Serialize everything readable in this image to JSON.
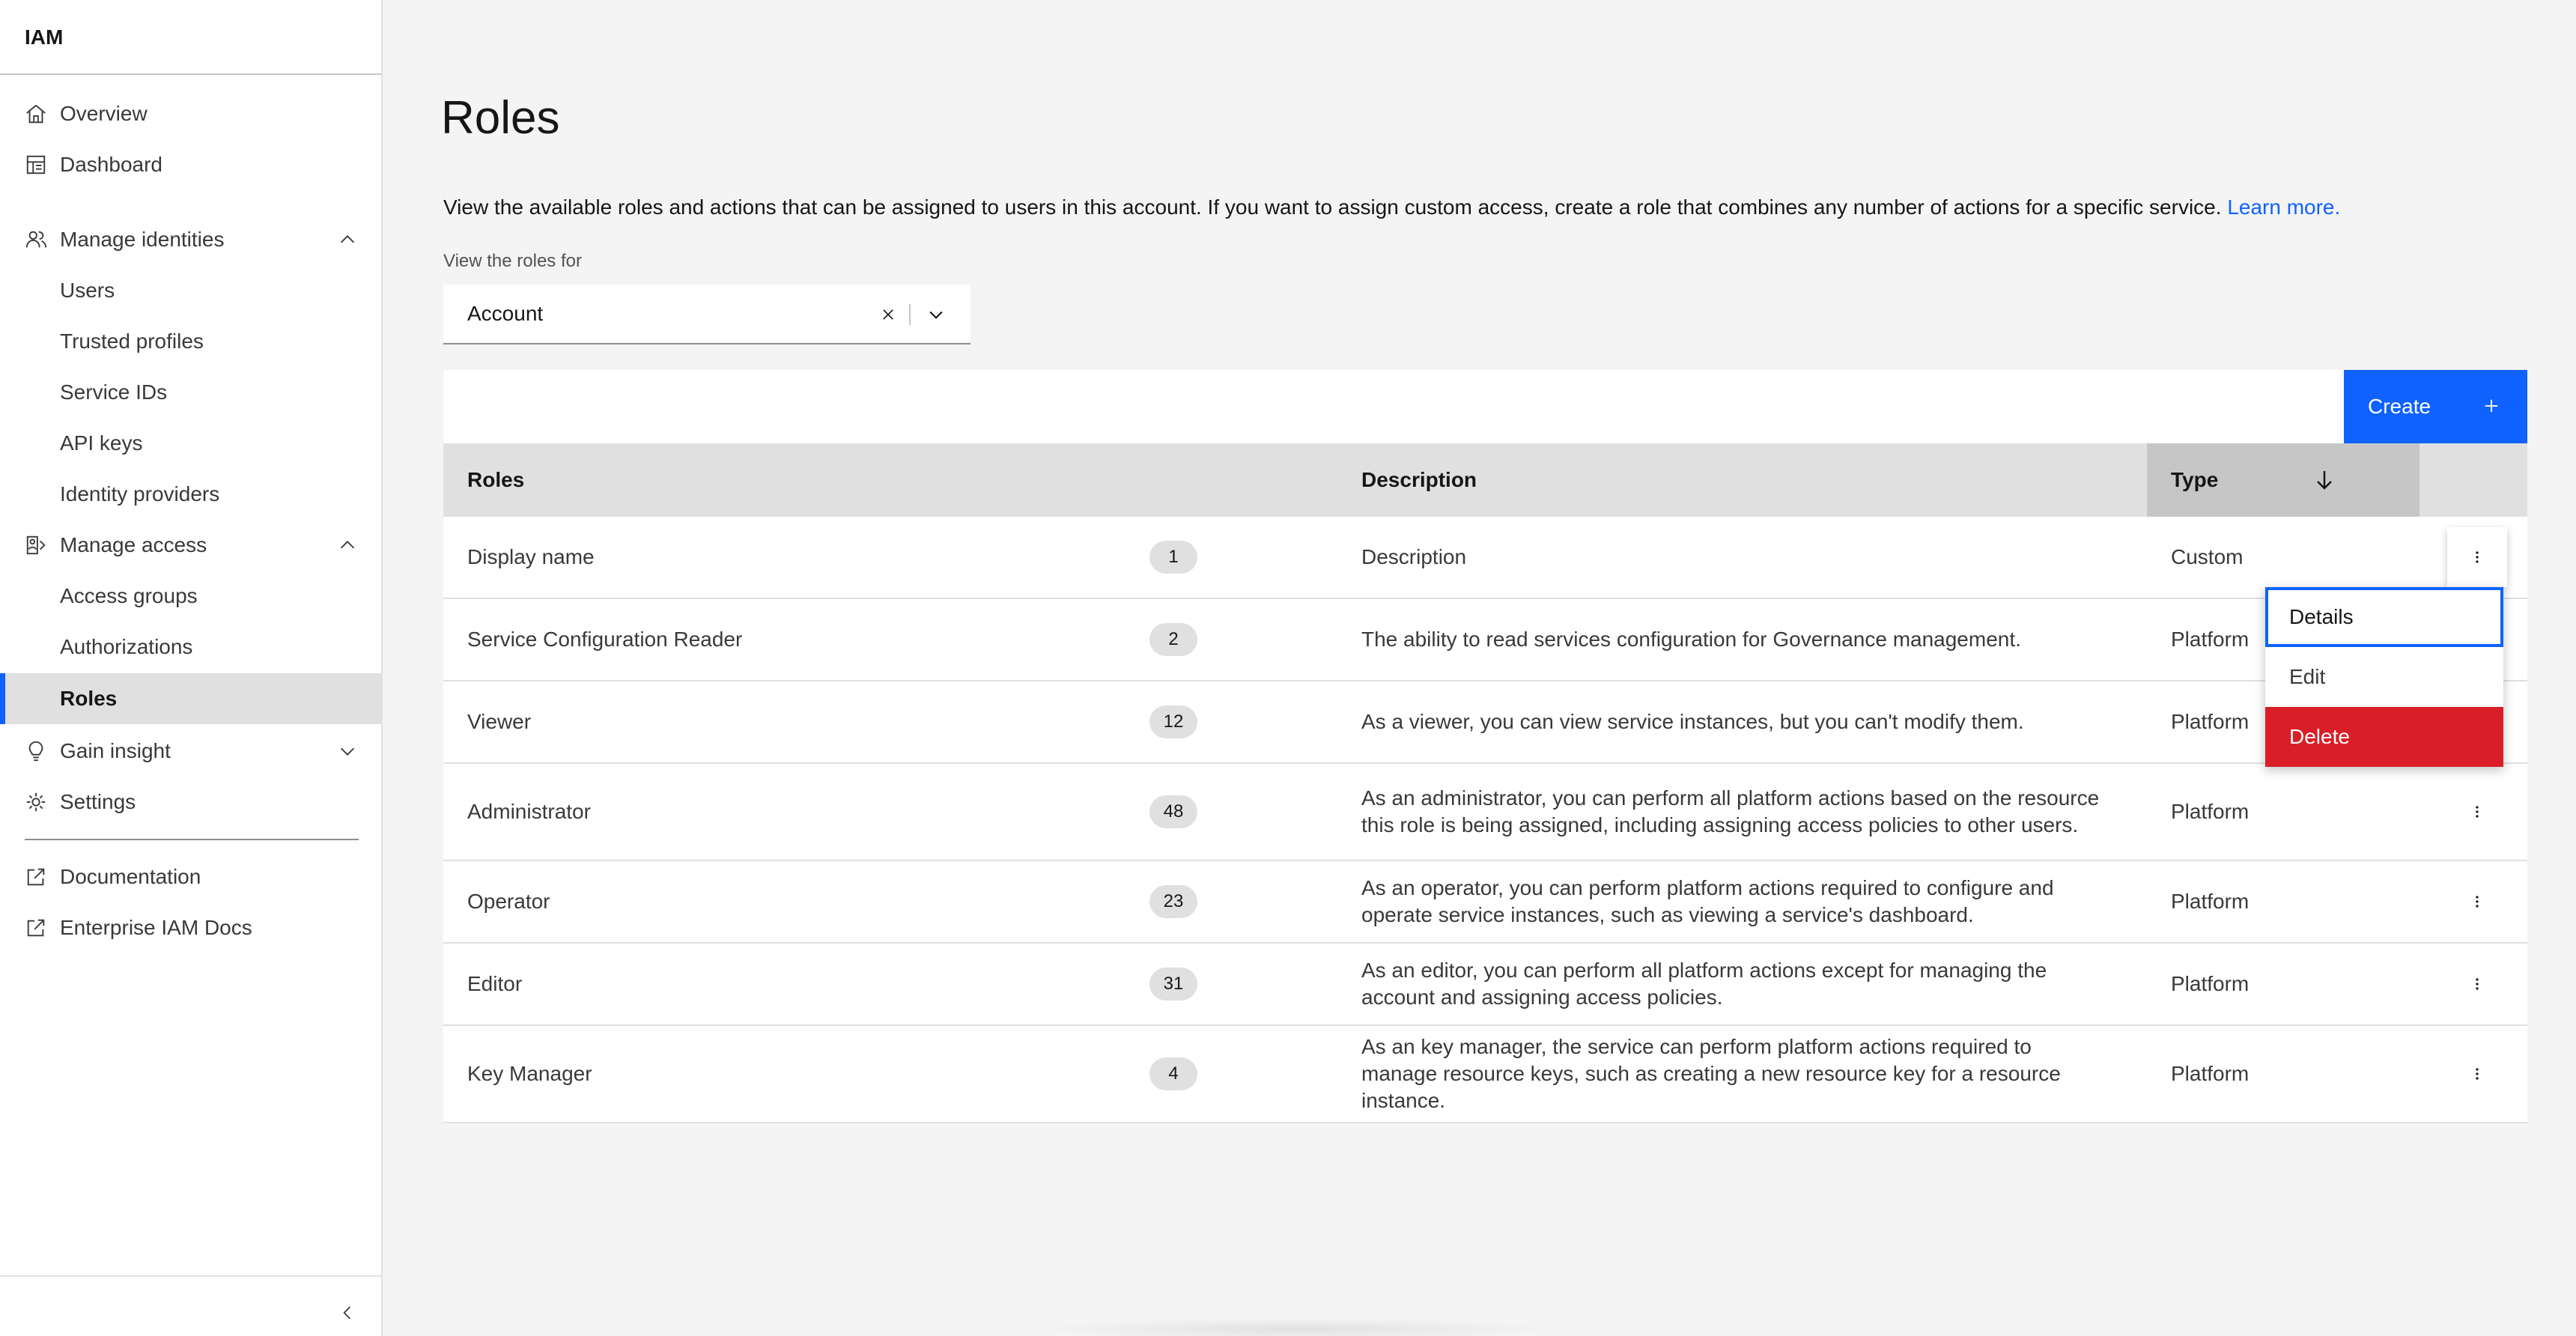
{
  "sidebar": {
    "title": "IAM",
    "items": [
      {
        "label": "Overview",
        "icon": "home-icon"
      },
      {
        "label": "Dashboard",
        "icon": "dashboard-icon"
      },
      {
        "label": "Manage identities",
        "icon": "user-multiple-icon",
        "expanded": true
      },
      {
        "label": "Users"
      },
      {
        "label": "Trusted profiles"
      },
      {
        "label": "Service IDs"
      },
      {
        "label": "API keys"
      },
      {
        "label": "Identity providers"
      },
      {
        "label": "Manage access",
        "icon": "access-icon",
        "expanded": true
      },
      {
        "label": "Access groups"
      },
      {
        "label": "Authorizations"
      },
      {
        "label": "Roles",
        "active": true
      },
      {
        "label": "Gain insight",
        "icon": "lightbulb-icon",
        "expanded": false
      },
      {
        "label": "Settings",
        "icon": "gear-icon"
      },
      {
        "label": "Documentation",
        "icon": "launch-icon"
      },
      {
        "label": "Enterprise IAM Docs",
        "icon": "launch-icon"
      }
    ]
  },
  "page": {
    "title": "Roles",
    "description": "View the available roles and actions that can be assigned to users in this account. If you want to assign custom access, create a role that combines any number of actions for a specific service.",
    "learn_more": "Learn more.",
    "filter_label": "View the roles for",
    "filter_value": "Account"
  },
  "toolbar": {
    "create_label": "Create"
  },
  "table": {
    "headers": {
      "roles": "Roles",
      "description": "Description",
      "type": "Type"
    },
    "sort": {
      "column": "type",
      "direction": "descending"
    },
    "rows": [
      {
        "name": "Display name",
        "count": "1",
        "description": "Description",
        "type": "Custom"
      },
      {
        "name": "Service Configuration Reader",
        "count": "2",
        "description": "The ability to read services configuration for Governance management.",
        "type": "Platform"
      },
      {
        "name": "Viewer",
        "count": "12",
        "description": "As a viewer, you can view service instances, but you can't modify them.",
        "type": "Platform"
      },
      {
        "name": "Administrator",
        "count": "48",
        "description": "As an administrator, you can perform all platform actions based on the resource this role is being assigned, including assigning access policies to other users.",
        "type": "Platform"
      },
      {
        "name": "Operator",
        "count": "23",
        "description": "As an operator, you can perform platform actions required to configure and operate service instances, such as viewing a service's dashboard.",
        "type": "Platform"
      },
      {
        "name": "Editor",
        "count": "31",
        "description": "As an editor, you can perform all platform actions except for managing the account and assigning access policies.",
        "type": "Platform"
      },
      {
        "name": "Key Manager",
        "count": "4",
        "description": "As an key manager, the service can perform platform actions required to manage resource keys, such as creating a new resource key for a resource instance.",
        "type": "Platform"
      }
    ]
  },
  "overflow_menu": {
    "open_row": 0,
    "items": [
      {
        "label": "Details",
        "focused": true
      },
      {
        "label": "Edit"
      },
      {
        "label": "Delete",
        "danger": true
      }
    ]
  },
  "colors": {
    "primary": "#0f62fe",
    "danger": "#da1e28",
    "active_nav_bg": "#e0e0e0"
  }
}
